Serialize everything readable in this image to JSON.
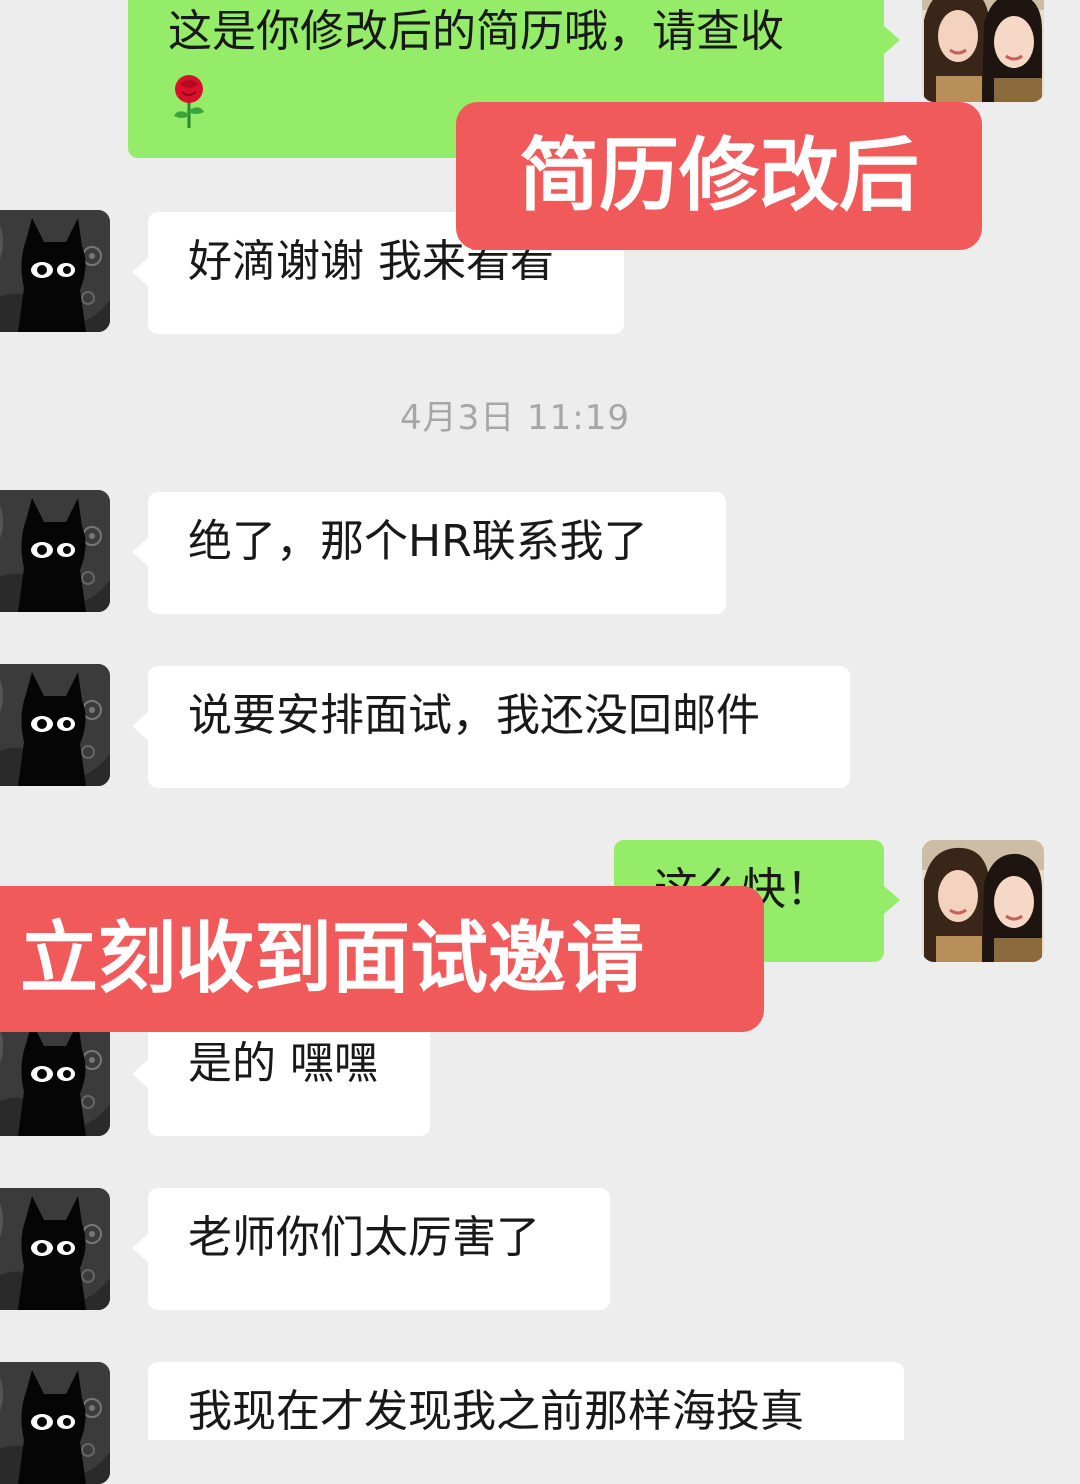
{
  "overlays": {
    "resume_revised": "简历修改后",
    "interview_invite": "立刻收到面试邀请"
  },
  "timestamp": "4月3日 11:19",
  "messages": [
    {
      "side": "out",
      "text": "这是你修改后的简历哦，请查收"
    },
    {
      "side": "in",
      "text": "好滴谢谢 我来看看"
    },
    {
      "side": "in",
      "text": "绝了，那个HR联系我了"
    },
    {
      "side": "in",
      "text": "说要安排面试，我还没回邮件"
    },
    {
      "side": "out",
      "text": "这么快！"
    },
    {
      "side": "in",
      "text": "是的 嘿嘿"
    },
    {
      "side": "in",
      "text": "老师你们太厉害了"
    },
    {
      "side": "in",
      "text": "我现在才发现我之前那样海投真"
    }
  ],
  "icons": {
    "rose": "rose-emoji",
    "contact_avatar": "black-cat-avatar",
    "self_avatar": "two-women-photo-avatar"
  },
  "colors": {
    "background": "#ededed",
    "outgoing_bubble": "#95ec69",
    "incoming_bubble": "#ffffff",
    "overlay_label": "#f15a5a",
    "timestamp_text": "#a6a6a6"
  }
}
